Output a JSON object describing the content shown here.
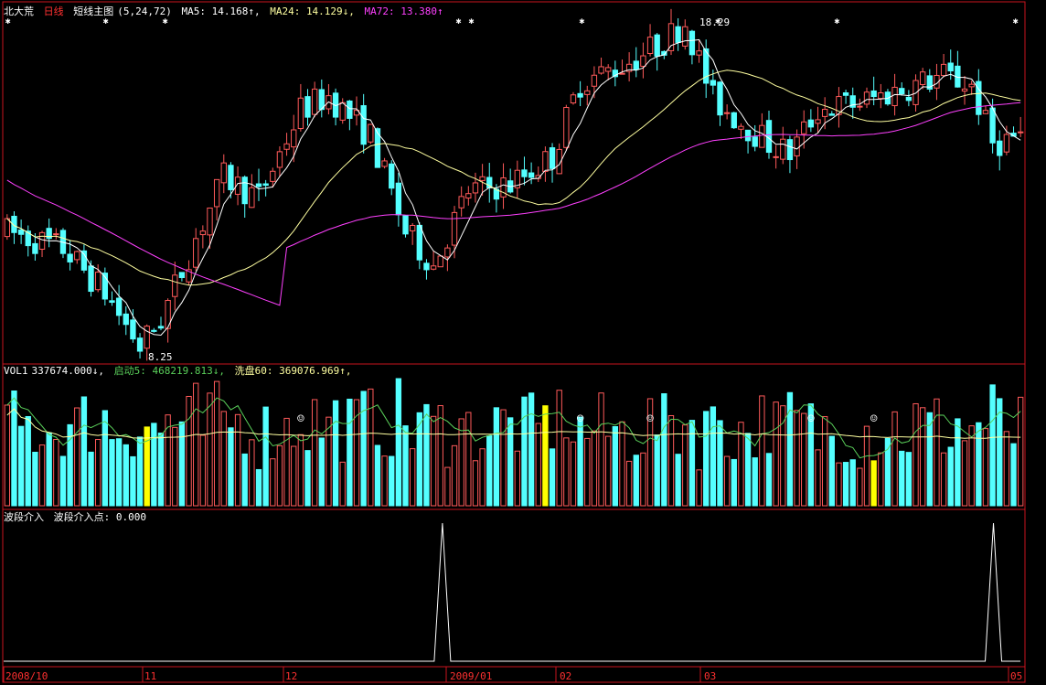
{
  "colors": {
    "bg": "#000000",
    "frame": "#c8141e",
    "up": "#ff5a5a",
    "down": "#54ffff",
    "ma5": "#ffffff",
    "ma24": "#ffffa0",
    "ma72": "#ff40ff",
    "vol_ma1": "#5ad05a",
    "vol_ma2": "#ffffa0",
    "yellow_bar": "#ffff00",
    "wave_line": "#ffffff",
    "title_red": "#ff3030",
    "dates": "#ff3030"
  },
  "main_header": {
    "stock": "北大荒",
    "period": "日线",
    "indicator": "短线主图",
    "params": "(5,24,72)",
    "ma5": "MA5: 14.168↑,",
    "ma24": "MA24: 14.129↓,",
    "ma72": "MA72: 13.380↑"
  },
  "vol_header": {
    "name": "VOL1",
    "vol": "337674.000↓,",
    "s5": "启动5: 468219.813↓,",
    "s60": "洗盘60: 369076.969↑,"
  },
  "wave_header": {
    "name": "波段介入",
    "value": "波段介入点: 0.000"
  },
  "annotations": {
    "high": "18.29",
    "low": "8.25"
  },
  "date_labels": [
    "2008/10",
    "11",
    "12",
    "2009/01",
    "02",
    "03",
    "05"
  ],
  "chart_data": [
    {
      "type": "candlestick",
      "title": "北大荒 日线 短线主图",
      "series": [
        {
          "name": "MA5",
          "value": 14.168
        },
        {
          "name": "MA24",
          "value": 14.129
        },
        {
          "name": "MA72",
          "value": 13.38
        }
      ],
      "high": 18.29,
      "low": 8.25,
      "x_labels": [
        "2008/10",
        "11",
        "12",
        "2009/01",
        "02",
        "03",
        "05"
      ]
    },
    {
      "type": "bar",
      "title": "VOL1",
      "series": [
        {
          "name": "VOL1",
          "value": 337674.0
        },
        {
          "name": "启动5",
          "value": 468219.813
        },
        {
          "name": "洗盘60",
          "value": 369076.969
        }
      ]
    },
    {
      "type": "line",
      "title": "波段介入",
      "series": [
        {
          "name": "波段介入点",
          "value": 0.0,
          "peaks_at_fraction": [
            0.43,
            0.97
          ]
        }
      ]
    }
  ]
}
